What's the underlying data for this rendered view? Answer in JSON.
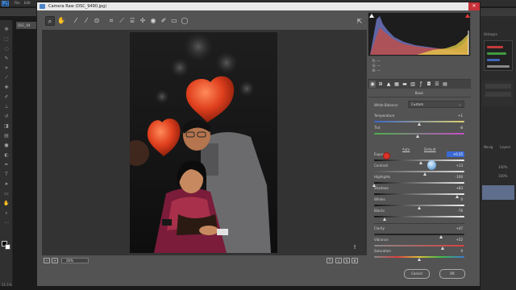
{
  "ps": {
    "logo": "Ps",
    "menus": [
      "File",
      "Edit",
      "Image",
      "Layer",
      "Type",
      "Select",
      "Filter",
      "3D",
      "View",
      "Window",
      "Help"
    ],
    "doc_tab": "DSC_94",
    "zoom_level": "11.1%",
    "right_panel": {
      "histogram_label": "Histogra",
      "navigator_label": "Navig",
      "layers_label": "Layers",
      "opacity": "100%",
      "fill": "100%"
    }
  },
  "dialog": {
    "title": "Camera Raw (DSC_9490.jpg)",
    "close_glyph": "✕",
    "zoom_level": "26%",
    "cancel_label": "Cancel",
    "ok_label": "OK",
    "rgb_readout": {
      "r_label": "R:",
      "g_label": "G:",
      "b_label": "B:",
      "r": "---",
      "g": "---",
      "b": "---"
    },
    "panel_title": "Basic",
    "white_balance": {
      "label": "White Balance:",
      "value": "Custom"
    },
    "auto_label": "Auto",
    "default_label": "Default",
    "sliders": [
      {
        "label": "Temperature",
        "value": "+1",
        "fraction": 0.5
      },
      {
        "label": "Tint",
        "value": "-8",
        "fraction": 0.48
      },
      {
        "label": "Exposure",
        "value": "+0.35",
        "fraction": 0.52
      },
      {
        "label": "Contrast",
        "value": "+13",
        "fraction": 0.56
      },
      {
        "label": "Highlights",
        "value": "-100",
        "fraction": 0.0
      },
      {
        "label": "Shadows",
        "value": "+83",
        "fraction": 0.92
      },
      {
        "label": "Whites",
        "value": "0",
        "fraction": 0.5
      },
      {
        "label": "Blacks",
        "value": "-76",
        "fraction": 0.12
      },
      {
        "label": "Clarity",
        "value": "+47",
        "fraction": 0.74
      },
      {
        "label": "Vibrance",
        "value": "+52",
        "fraction": 0.76
      },
      {
        "label": "Saturation",
        "value": "0",
        "fraction": 0.5
      }
    ]
  },
  "colors": {
    "accent_blue": "#3a6ad6",
    "balloon_red": "#d8381c",
    "close_red": "#c8323a"
  }
}
